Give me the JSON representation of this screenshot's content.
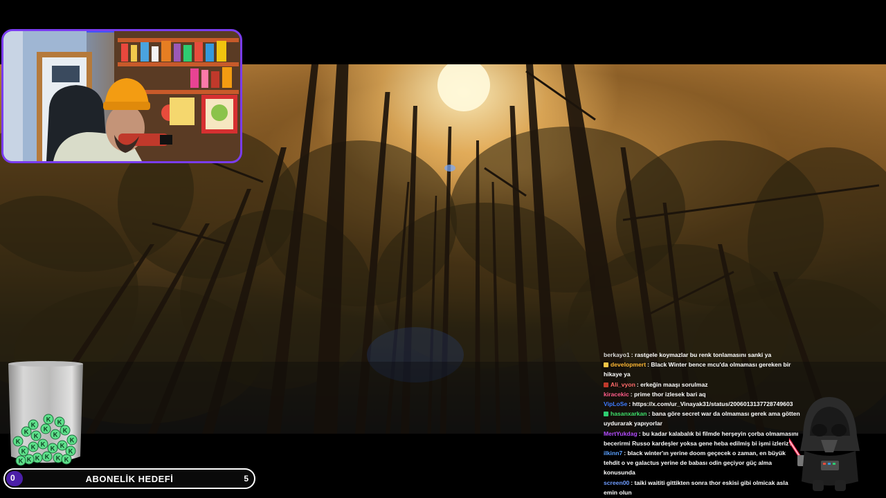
{
  "stream": {
    "subscription_goal": {
      "title": "ABONELİK HEDEFİ",
      "current": "0",
      "target": "5",
      "progress": 0,
      "accent_color": "#4b1fa8"
    },
    "webcam": {
      "border_color": "#7a3cf0"
    },
    "jar": {
      "badge_letter": "K",
      "badge_color": "#5de08a"
    }
  },
  "chat": {
    "messages": [
      {
        "user": "berkayo1",
        "user_color": "#d9d9d9",
        "badge_color": "",
        "text": "rastgele koymazlar bu renk tonlamasını sanki ya"
      },
      {
        "user": "developmert",
        "user_color": "#ffb733",
        "badge_color": "#f6c445",
        "text": "Black Winter bence mcu'da olmaması gereken bir hikaye ya"
      },
      {
        "user": "Ali_vyon",
        "user_color": "#ff6a6a",
        "badge_color": "#c0392b",
        "text": "erkeğin maaşı sorulmaz"
      },
      {
        "user": "kiracekic",
        "user_color": "#ff5c8a",
        "badge_color": "",
        "text": "prime thor izlesek bari aq"
      },
      {
        "user": "VipLoSe",
        "user_color": "#3d7bff",
        "badge_color": "",
        "text": "https://x.com/ur_Vinayak31/status/2006013137728749603"
      },
      {
        "user": "hasanxarkan",
        "user_color": "#3ee06b",
        "badge_color": "#2ecc71",
        "text": "bana göre secret war da olmaması gerek ama götten uydurarak yapıyorlar"
      },
      {
        "user": "MertYukdag",
        "user_color": "#b44dff",
        "badge_color": "",
        "text": "bu kadar kalabalık bi filmde herşeyin çorba olmamasını becerirmi Russo kardeşler yoksa gene heba edilmiş bi işmi izleriz?"
      },
      {
        "user": "ilkinn7",
        "user_color": "#5aa0ff",
        "badge_color": "",
        "text": "black winter'ın yerine doom geçecek o zaman, en büyük tehdit o ve galactus yerine de babası odin geçiyor güç alma konusunda"
      },
      {
        "user": "screen00",
        "user_color": "#6f9cff",
        "badge_color": "",
        "text": "taiki waititi gittikten sonra thor eskisi gibi olmicak asla emin olun"
      }
    ]
  }
}
